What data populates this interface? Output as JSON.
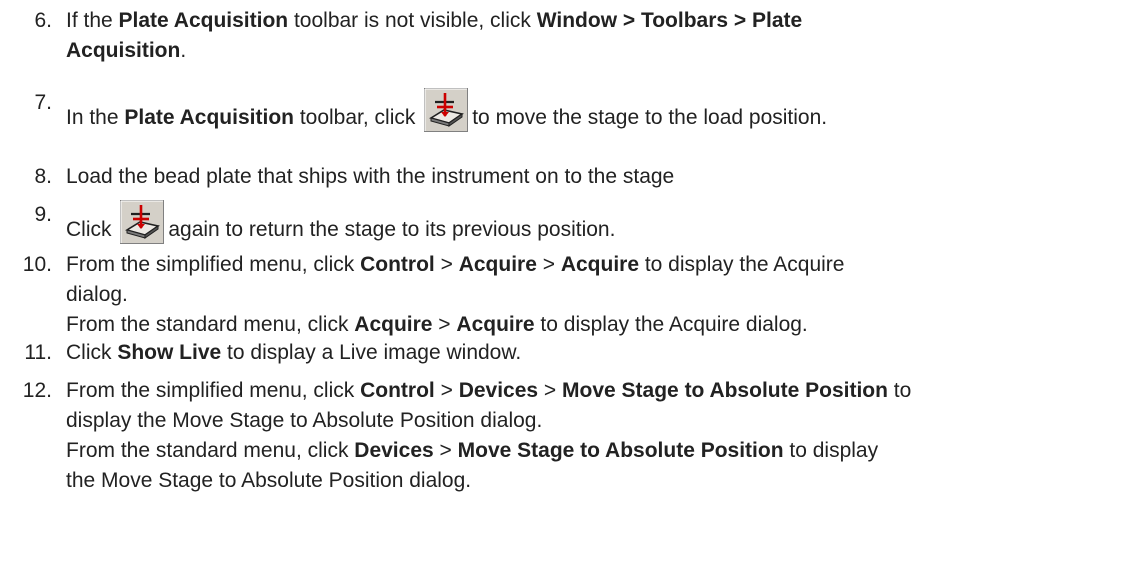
{
  "steps": [
    {
      "number": "6.",
      "lines": [
        [
          "If the ",
          {
            "b": "Plate Acquisition"
          },
          " toolbar is not visible, click ",
          {
            "b": "Window > Toolbars > Plate"
          }
        ],
        [
          {
            "b": "Acquisition"
          },
          "."
        ]
      ]
    },
    {
      "number": "7.",
      "lines": [
        [
          "In the ",
          {
            "b": "Plate Acquisition"
          },
          " toolbar, click ",
          {
            "icon": "stage-load-icon"
          },
          "to move the stage to the load position."
        ]
      ]
    },
    {
      "number": "8.",
      "lines": [
        [
          "Load the bead plate that ships with the instrument on to the stage"
        ]
      ]
    },
    {
      "number": "9.",
      "lines": [
        [
          "Click ",
          {
            "icon": "stage-load-icon"
          },
          "again to return the stage to its previous position."
        ]
      ]
    },
    {
      "number": "10.",
      "lines": [
        [
          "From the simplified menu, click ",
          {
            "b": "Control"
          },
          " > ",
          {
            "b": "Acquire"
          },
          " > ",
          {
            "b": "Acquire"
          },
          " to display the Acquire"
        ],
        [
          "dialog."
        ],
        [
          "From the standard menu, click ",
          {
            "b": "Acquire"
          },
          " > ",
          {
            "b": "Acquire"
          },
          " to display the Acquire dialog."
        ]
      ]
    },
    {
      "number": "11.",
      "lines": [
        [
          "Click ",
          {
            "b": "Show Live"
          },
          " to display a Live image window."
        ]
      ]
    },
    {
      "number": "12.",
      "lines": [
        [
          "From the simplified menu, click ",
          {
            "b": "Control"
          },
          " > ",
          {
            "b": "Devices"
          },
          " > ",
          {
            "b": "Move Stage to Absolute Position"
          },
          " to"
        ],
        [
          "display the Move Stage to Absolute Position dialog."
        ],
        [
          "From the standard menu, click ",
          {
            "b": "Devices"
          },
          " > ",
          {
            "b": "Move Stage to Absolute Position"
          },
          " to display"
        ],
        [
          "the Move Stage to Absolute Position dialog."
        ]
      ]
    }
  ],
  "colors": {
    "text": "#222222",
    "icon_face": "#d4d0c8",
    "icon_accent": "#cc0000"
  }
}
